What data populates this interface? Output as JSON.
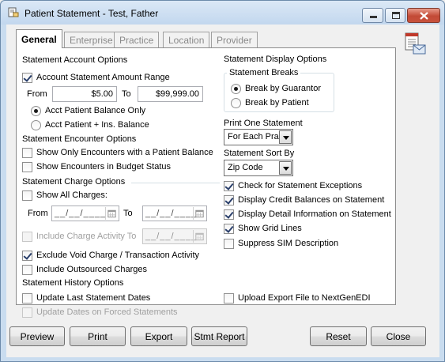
{
  "window": {
    "title": "Patient Statement - Test, Father",
    "icons": {
      "app": "statement-app-icon",
      "minimize": "minimize-icon",
      "maximize": "maximize-icon",
      "close": "close-icon",
      "report": "report-envelope-icon"
    }
  },
  "tabs": [
    {
      "label": "General",
      "active": true
    },
    {
      "label": "Enterprise",
      "active": false
    },
    {
      "label": "Practice",
      "active": false
    },
    {
      "label": "Location",
      "active": false
    },
    {
      "label": "Provider",
      "active": false
    }
  ],
  "account_options": {
    "heading": "Statement Account Options",
    "amount_range": {
      "label": "Account Statement Amount Range",
      "checked": true,
      "from_label": "From",
      "from_value": "$5.00",
      "to_label": "To",
      "to_value": "$99,999.00"
    },
    "radios": [
      {
        "label": "Acct Patient Balance Only",
        "selected": true
      },
      {
        "label": "Acct Patient + Ins. Balance",
        "selected": false
      }
    ]
  },
  "encounter_options": {
    "heading": "Statement Encounter Options",
    "items": [
      {
        "label": "Show Only Encounters with a Patient Balance",
        "checked": false
      },
      {
        "label": "Show Encounters in Budget Status",
        "checked": false
      }
    ]
  },
  "charge_options": {
    "heading": "Statement Charge Options",
    "show_all": {
      "label": "Show All Charges:",
      "checked": false
    },
    "from_label": "From",
    "to_label": "To",
    "date_placeholder": "__/__/____",
    "include_activity": {
      "label": "Include Charge Activity To",
      "checked": false,
      "disabled": true
    },
    "exclude_void": {
      "label": "Exclude Void Charge / Transaction Activity",
      "checked": true
    },
    "include_outsourced": {
      "label": "Include Outsourced Charges",
      "checked": false
    }
  },
  "history_options": {
    "heading": "Statement History Options",
    "update_last": {
      "label": "Update Last Statement Dates",
      "checked": false
    },
    "update_forced": {
      "label": "Update Dates on Forced Statements",
      "checked": false,
      "disabled": true
    }
  },
  "display_options": {
    "heading": "Statement Display Options",
    "breaks": {
      "title": "Statement Breaks",
      "radios": [
        {
          "label": "Break by Guarantor",
          "selected": true
        },
        {
          "label": "Break by Patient",
          "selected": false
        }
      ]
    },
    "print_one": {
      "label": "Print One Statement",
      "value": "For Each Pra"
    },
    "sort_by": {
      "label": "Statement Sort By",
      "value": "Zip Code"
    },
    "checks": [
      {
        "label": "Check for Statement Exceptions",
        "checked": true
      },
      {
        "label": "Display Credit Balances on Statement",
        "checked": true
      },
      {
        "label": "Display Detail Information on Statement",
        "checked": true
      },
      {
        "label": "Show Grid Lines",
        "checked": true
      },
      {
        "label": "Suppress SIM Description",
        "checked": false
      }
    ],
    "upload_export": {
      "label": "Upload Export File to NextGenEDI",
      "checked": false
    }
  },
  "buttons": {
    "preview": "Preview",
    "print": "Print",
    "export": "Export",
    "stmt_report": "Stmt Report",
    "reset": "Reset",
    "close": "Close"
  }
}
